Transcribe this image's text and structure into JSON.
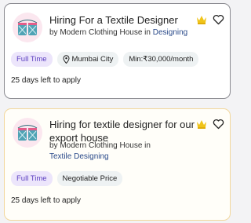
{
  "jobs": [
    {
      "title": "Hiring For a Textile Designer",
      "company_prefix": "by Modern Clothing House in",
      "category": "Designing",
      "tags": {
        "type": "Full Time",
        "location": "Mumbai City",
        "salary": "Min:₹30,000/month"
      },
      "deadline": "25 days left to apply",
      "premium": true,
      "saved": false
    },
    {
      "title": "Hiring for textile designer for our export house",
      "company_prefix": "by Modern Clothing House in",
      "category": "Textile Designing",
      "tags": {
        "type": "Full Time",
        "salary": "Negotiable Price"
      },
      "deadline": "25 days left to apply",
      "premium": true,
      "saved": false
    }
  ],
  "colors": {
    "crown": "#f0c419",
    "type_tag_bg": "#ece5fb",
    "type_tag_text": "#5b3ec0",
    "card2_border": "#f2d79c"
  },
  "icons": {
    "crown": "crown-icon",
    "heart": "heart-icon",
    "location": "location-pin-icon",
    "logo": "textile-logo-icon"
  }
}
